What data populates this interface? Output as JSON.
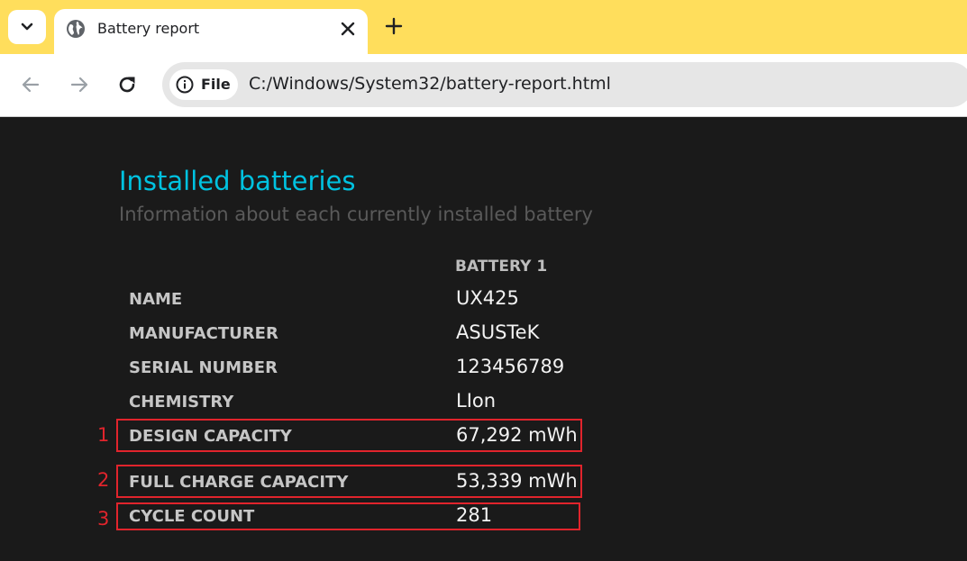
{
  "browser": {
    "tab": {
      "title": "Battery report"
    },
    "address_bar": {
      "chip_label": "File",
      "url": "C:/Windows/System32/battery-report.html"
    }
  },
  "report": {
    "heading": "Installed batteries",
    "subheading": "Information about each currently installed battery",
    "column_header": "BATTERY 1",
    "rows": [
      {
        "label": "NAME",
        "value": "UX425"
      },
      {
        "label": "MANUFACTURER",
        "value": "ASUSTeK"
      },
      {
        "label": "SERIAL NUMBER",
        "value": "123456789"
      },
      {
        "label": "CHEMISTRY",
        "value": "LIon"
      },
      {
        "label": "DESIGN CAPACITY",
        "value": "67,292 mWh"
      },
      {
        "label": "FULL CHARGE CAPACITY",
        "value": "53,339 mWh"
      },
      {
        "label": "CYCLE COUNT",
        "value": "281"
      }
    ]
  },
  "annotations": [
    "1",
    "2",
    "3"
  ],
  "colors": {
    "tab_strip": "#ffde5c",
    "page_background": "#1a1a1a",
    "heading": "#00c2e0",
    "highlight": "#e1242c"
  },
  "icons": {
    "tab_search": "chevron-down-icon",
    "tab_favicon": "globe-icon",
    "tab_close": "close-icon",
    "new_tab": "plus-icon",
    "back": "arrow-left-icon",
    "forward": "arrow-right-icon",
    "reload": "reload-icon",
    "site_info": "info-icon"
  }
}
